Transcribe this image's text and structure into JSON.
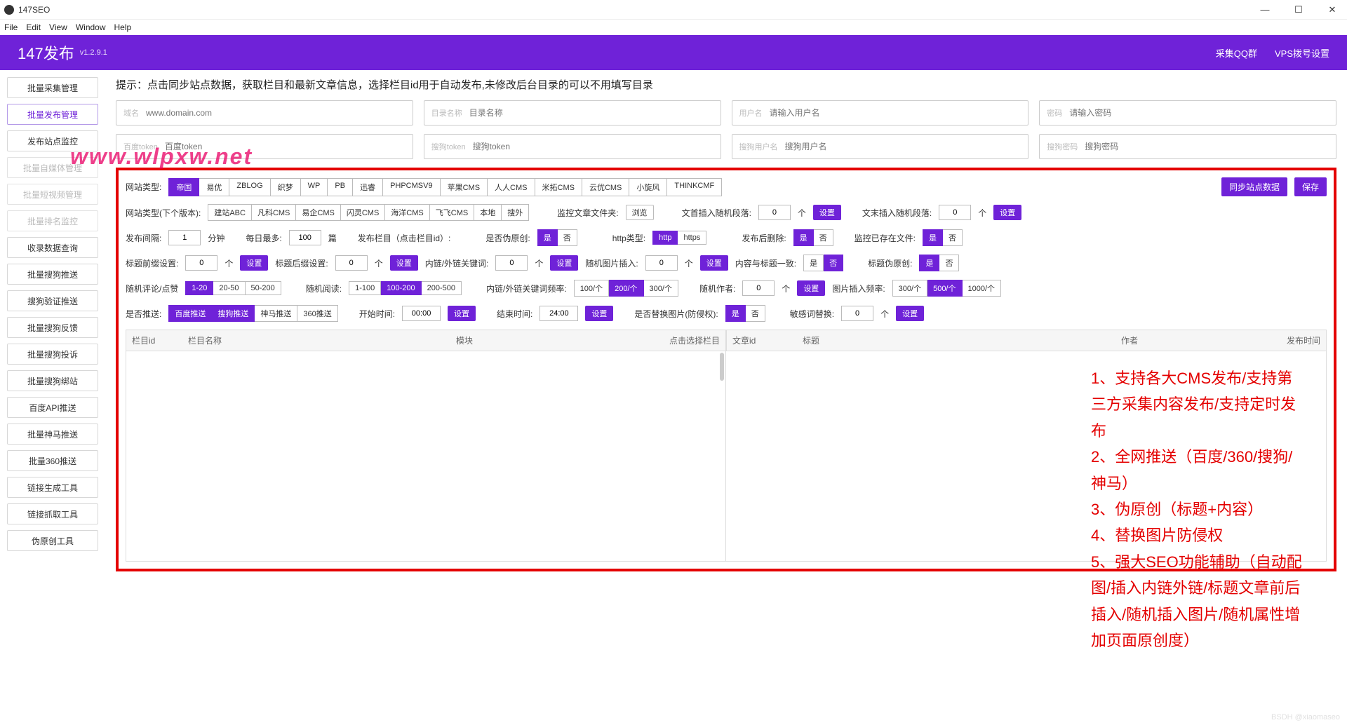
{
  "window": {
    "title": "147SEO"
  },
  "menus": [
    "File",
    "Edit",
    "View",
    "Window",
    "Help"
  ],
  "winctrl": {
    "min": "—",
    "max": "☐",
    "close": "✕"
  },
  "header": {
    "brand": "147发布",
    "ver": "v1.2.9.1",
    "links": [
      "采集QQ群",
      "VPS拨号设置"
    ]
  },
  "sidebar": [
    {
      "label": "批量采集管理",
      "state": "normal"
    },
    {
      "label": "批量发布管理",
      "state": "active"
    },
    {
      "label": "发布站点监控",
      "state": "normal"
    },
    {
      "label": "批量自媒体管理",
      "state": "disabled"
    },
    {
      "label": "批量短视频管理",
      "state": "disabled"
    },
    {
      "label": "批量排名监控",
      "state": "disabled"
    },
    {
      "label": "收录数据查询",
      "state": "normal"
    },
    {
      "label": "批量搜狗推送",
      "state": "normal"
    },
    {
      "label": "搜狗验证推送",
      "state": "normal"
    },
    {
      "label": "批量搜狗反馈",
      "state": "normal"
    },
    {
      "label": "批量搜狗投诉",
      "state": "normal"
    },
    {
      "label": "批量搜狗绑站",
      "state": "normal"
    },
    {
      "label": "百度API推送",
      "state": "normal"
    },
    {
      "label": "批量神马推送",
      "state": "normal"
    },
    {
      "label": "批量360推送",
      "state": "normal"
    },
    {
      "label": "链接生成工具",
      "state": "normal"
    },
    {
      "label": "链接抓取工具",
      "state": "normal"
    },
    {
      "label": "伪原创工具",
      "state": "normal"
    }
  ],
  "tip": "提示：点击同步站点数据，获取栏目和最新文章信息，选择栏目id用于自动发布,未修改后台目录的可以不用填写目录",
  "fields": {
    "domain": {
      "lab": "域名",
      "ph": "www.domain.com"
    },
    "dir": {
      "lab": "目录名称",
      "ph": "目录名称"
    },
    "user": {
      "lab": "用户名",
      "ph": "请输入用户名"
    },
    "pass": {
      "lab": "密码",
      "ph": "请输入密码"
    },
    "bdtoken": {
      "lab": "百度token",
      "ph": "百度token"
    },
    "sgtoken": {
      "lab": "搜狗token",
      "ph": "搜狗token"
    },
    "sguser": {
      "lab": "搜狗用户名",
      "ph": "搜狗用户名"
    },
    "sgpass": {
      "lab": "搜狗密码",
      "ph": "搜狗密码"
    }
  },
  "actions": {
    "sync": "同步站点数据",
    "save": "保存",
    "browse": "浏览",
    "set": "设置"
  },
  "labels": {
    "site_type": "网站类型:",
    "site_type_next": "网站类型(下个版本):",
    "monitor_folder": "监控文章文件夹:",
    "insert_head": "文首插入随机段落:",
    "insert_tail": "文末插入随机段落:",
    "interval": "发布间隔:",
    "minutes": "分钟",
    "daily_max": "每日最多:",
    "pages": "篇",
    "publish_col": "发布栏目（点击栏目id）:",
    "pseudo": "是否伪原创:",
    "http_type": "http类型:",
    "del_after": "发布后删除:",
    "monitor_exist": "监控已存在文件:",
    "title_prefix": "标题前缀设置:",
    "title_suffix": "标题后缀设置:",
    "keyword_link": "内链/外链关键词:",
    "rand_img": "随机图片插入:",
    "content_match": "内容与标题一致:",
    "title_pseudo": "标题伪原创:",
    "rand_comment": "随机评论/点赞",
    "rand_read": "随机阅读:",
    "keyword_freq": "内链/外链关键词频率:",
    "rand_author": "随机作者:",
    "img_freq": "图片插入频率:",
    "push": "是否推送:",
    "start_time": "开始时间:",
    "end_time": "结束时间:",
    "replace_img": "是否替换图片(防侵权):",
    "sensitive": "敏感词替换:",
    "unit_ge": "个",
    "unit_per": "个"
  },
  "cms": [
    "帝国",
    "易优",
    "ZBLOG",
    "织梦",
    "WP",
    "PB",
    "迅睿",
    "PHPCMSV9",
    "苹果CMS",
    "人人CMS",
    "米拓CMS",
    "云优CMS",
    "小旋风",
    "THINKCMF"
  ],
  "cms_sel": 0,
  "cms_next": [
    "建站ABC",
    "凡科CMS",
    "易企CMS",
    "闪灵CMS",
    "海洋CMS",
    "飞飞CMS",
    "本地",
    "搜外"
  ],
  "values": {
    "head_num": "0",
    "tail_num": "0",
    "interval": "1",
    "daily": "100",
    "prefix": "0",
    "suffix": "0",
    "keyword": "0",
    "randimg": "0",
    "author": "0",
    "sensitive": "0",
    "start": "00:00",
    "end": "24:00"
  },
  "yesno": {
    "yes": "是",
    "no": "否"
  },
  "http": [
    "http",
    "https"
  ],
  "comment_opts": [
    "1-20",
    "20-50",
    "50-200"
  ],
  "read_opts": [
    "1-100",
    "100-200",
    "200-500"
  ],
  "kwfreq_opts": [
    "100/个",
    "200/个",
    "300/个"
  ],
  "imgfreq_opts": [
    "300/个",
    "500/个",
    "1000/个"
  ],
  "push_opts": [
    "百度推送",
    "搜狗推送",
    "神马推送",
    "360推送"
  ],
  "table1_headers": [
    "栏目id",
    "栏目名称",
    "模块",
    "点击选择栏目"
  ],
  "table2_headers": [
    "文章id",
    "标题",
    "作者",
    "发布时间"
  ],
  "features": [
    "1、支持各大CMS发布/支持第三方采集内容发布/支持定时发布",
    "2、全网推送（百度/360/搜狗/神马）",
    "3、伪原创（标题+内容）",
    "4、替换图片防侵权",
    "5、强大SEO功能辅助（自动配图/插入内链外链/标题文章前后插入/随机插入图片/随机属性增加页面原创度）"
  ],
  "watermark": "www.wlpxw.net",
  "bottom_wm": "BSDH @xiaomaseo"
}
